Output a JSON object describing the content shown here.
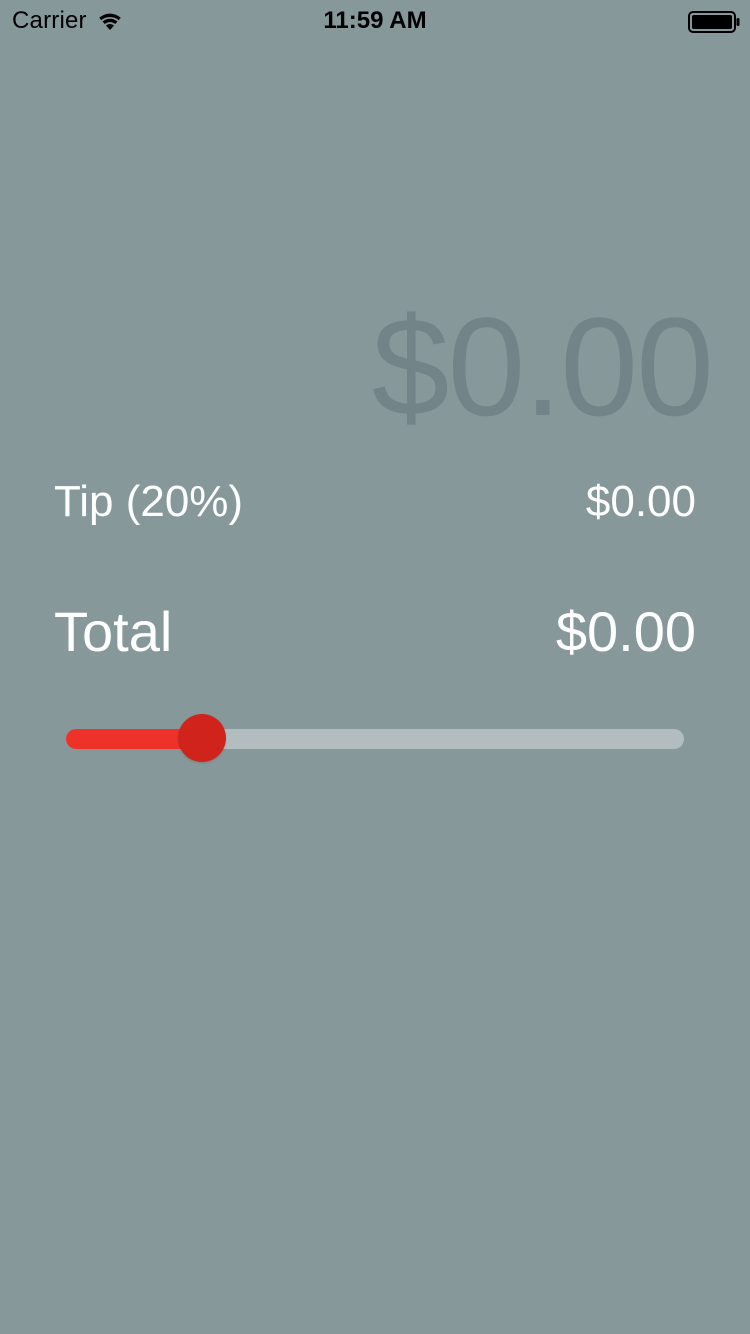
{
  "status_bar": {
    "carrier": "Carrier",
    "time": "11:59 AM",
    "wifi_icon": "wifi-icon",
    "battery_icon": "battery-icon"
  },
  "bill": {
    "amount": "$0.00"
  },
  "tip": {
    "label": "Tip (20%)",
    "value": "$0.00"
  },
  "total": {
    "label": "Total",
    "value": "$0.00"
  },
  "slider": {
    "fraction": 0.22,
    "fill_color": "#ee3229",
    "thumb_color": "#d0231c",
    "track_color": "#b3bcbf"
  },
  "colors": {
    "background": "#86989a",
    "bill_text": "#738488",
    "text": "#ffffff"
  }
}
